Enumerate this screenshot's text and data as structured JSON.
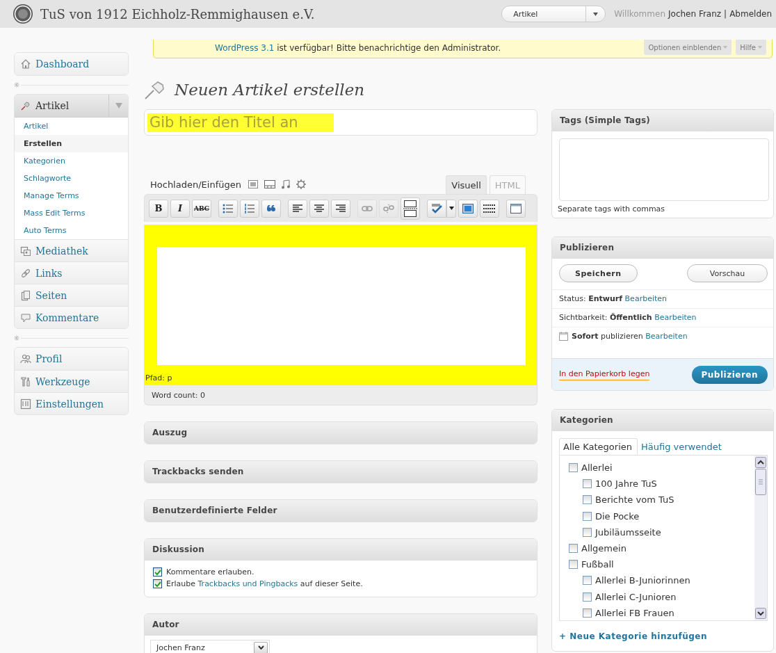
{
  "header": {
    "site_title": "TuS von 1912 Eichholz-Remmighausen e.V.",
    "quick_menu": "Artikel",
    "greeting": "Willkommen",
    "user": "Jochen Franz",
    "separator": "|",
    "logout": "Abmelden"
  },
  "notice": {
    "link": "WordPress 3.1",
    "text": " ist verfügbar! Bitte benachrichtige den Administrator."
  },
  "screen_tabs": [
    "Optionen einblenden",
    "Hilfe"
  ],
  "sidebar": {
    "groups": [
      [
        {
          "label": "Dashboard",
          "kind": "dashboard"
        }
      ],
      [
        {
          "label": "Artikel",
          "kind": "posts",
          "expanded": true,
          "children": [
            {
              "label": "Artikel",
              "selected": false
            },
            {
              "label": "Erstellen",
              "selected": true
            },
            {
              "label": "Kategorien",
              "selected": false
            },
            {
              "label": "Schlagworte",
              "selected": false
            },
            {
              "label": "Manage Terms",
              "selected": false
            },
            {
              "label": "Mass Edit Terms",
              "selected": false
            },
            {
              "label": "Auto Terms",
              "selected": false
            }
          ]
        },
        {
          "label": "Mediathek",
          "kind": "media"
        },
        {
          "label": "Links",
          "kind": "links"
        },
        {
          "label": "Seiten",
          "kind": "pages"
        },
        {
          "label": "Kommentare",
          "kind": "comments"
        }
      ],
      [
        {
          "label": "Profil",
          "kind": "profile"
        },
        {
          "label": "Werkzeuge",
          "kind": "tools"
        },
        {
          "label": "Einstellungen",
          "kind": "settings"
        }
      ]
    ]
  },
  "page_title": "Neuen Artikel erstellen",
  "title_field": {
    "placeholder": "Gib hier den Titel an"
  },
  "editor": {
    "upload_label": "Hochladen/Einfügen",
    "tabs": [
      {
        "label": "Visuell",
        "selected": true
      },
      {
        "label": "HTML",
        "selected": false
      }
    ],
    "toolbar": [
      {
        "kind": "bold",
        "label": "B",
        "disabled": false
      },
      {
        "kind": "italic",
        "label": "I",
        "disabled": false
      },
      {
        "kind": "strikethrough",
        "label": "ABC",
        "disabled": false
      },
      {
        "kind": "bullet-list",
        "disabled": false
      },
      {
        "kind": "numbered-list",
        "disabled": false
      },
      {
        "kind": "blockquote",
        "disabled": false
      },
      {
        "kind": "align-left",
        "disabled": false
      },
      {
        "kind": "align-center",
        "disabled": false
      },
      {
        "kind": "align-right",
        "disabled": false
      },
      {
        "kind": "link",
        "disabled": true
      },
      {
        "kind": "unlink",
        "disabled": true
      },
      {
        "kind": "more",
        "disabled": false
      },
      {
        "kind": "spellcheck",
        "disabled": false
      },
      {
        "kind": "fullscreen",
        "disabled": false
      },
      {
        "kind": "kitchen-sink",
        "disabled": false
      },
      {
        "kind": "window",
        "disabled": false
      }
    ],
    "path": "Pfad: p",
    "word_count": "Word count: 0"
  },
  "main_boxes": [
    {
      "title": "Auszug",
      "kind": "closed"
    },
    {
      "title": "Trackbacks senden",
      "kind": "closed"
    },
    {
      "title": "Benutzerdefinierte Felder",
      "kind": "closed"
    },
    {
      "title": "Diskussion",
      "kind": "discussion",
      "options": [
        {
          "checked": true,
          "parts": [
            {
              "kind": "text",
              "text": "Kommentare erlauben."
            }
          ]
        },
        {
          "checked": true,
          "parts": [
            {
              "kind": "text",
              "text": "Erlaube "
            },
            {
              "kind": "link",
              "text": "Trackbacks und Pingbacks"
            },
            {
              "kind": "text",
              "text": " auf dieser Seite."
            }
          ]
        }
      ]
    },
    {
      "title": "Autor",
      "kind": "author",
      "value": "Jochen Franz"
    }
  ],
  "side_boxes": [
    {
      "title": "Tags (Simple Tags)",
      "kind": "tags",
      "hint": "Separate tags with commas"
    },
    {
      "title": "Publizieren",
      "kind": "publish",
      "buttons": [
        "Speichern",
        "Vorschau"
      ],
      "rows": [
        {
          "kind": "status",
          "text": "Status: **Entwurf**",
          "link": "Bearbeiten"
        },
        {
          "kind": "visibility",
          "text": "Sichtbarkeit: **Öffentlich**",
          "link": "Bearbeiten"
        },
        {
          "kind": "schedule",
          "text": "**Sofort** publizieren",
          "link": "Bearbeiten"
        }
      ],
      "trash": "In den Papierkorb legen",
      "primary": "Publizieren"
    },
    {
      "title": "Kategorien",
      "kind": "categories",
      "tabs": [
        {
          "label": "Alle Kategorien",
          "selected": true
        },
        {
          "label": "Häufig verwendet",
          "selected": false
        }
      ],
      "items": [
        {
          "label": "Allerlei",
          "checked": false,
          "children": [
            {
              "label": "100 Jahre TuS",
              "checked": false
            },
            {
              "label": "Berichte vom TuS",
              "checked": false
            },
            {
              "label": "Die Pocke",
              "checked": false
            },
            {
              "label": "Jubiläumsseite",
              "checked": false
            }
          ]
        },
        {
          "label": "Allgemein",
          "checked": false
        },
        {
          "label": "Fußball",
          "checked": false,
          "children": [
            {
              "label": "Allerlei B-Juniorinnen",
              "checked": false
            },
            {
              "label": "Allerlei C-Junioren",
              "checked": false
            },
            {
              "label": "Allerlei FB Frauen",
              "checked": false
            }
          ]
        }
      ],
      "add_link": "+ Neue Kategorie hinzufügen"
    }
  ]
}
